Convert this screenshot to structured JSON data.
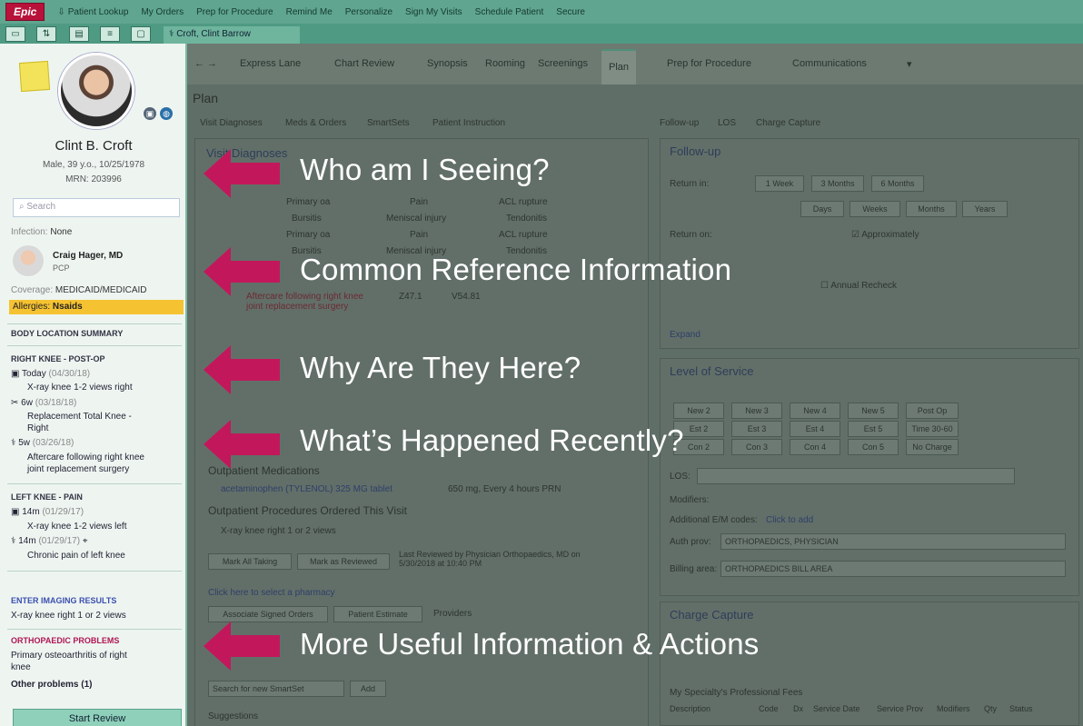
{
  "toolbar": {
    "brand": "Epic",
    "items": [
      "Patient Lookup",
      "My Orders",
      "Prep for Procedure",
      "Remind Me",
      "Personalize",
      "Sign My Visits",
      "Schedule Patient",
      "Secure"
    ]
  },
  "patient_tab": {
    "label": "Croft, Clint Barrow"
  },
  "sidebar": {
    "name": "Clint B. Croft",
    "demographics": "Male, 39 y.o., 10/25/1978",
    "mrn": "MRN: 203996",
    "search_placeholder": "Search",
    "infection_label": "Infection:",
    "infection_value": "None",
    "pcp_name": "Craig Hager, MD",
    "pcp_role": "PCP",
    "coverage_label": "Coverage:",
    "coverage_value": "MEDICAID/MEDICAID",
    "allergies_label": "Allergies:",
    "allergies_value": "Nsaids",
    "body_location_header": "BODY LOCATION SUMMARY",
    "right_knee_header": "RIGHT KNEE - POST-OP",
    "rk1_when": "Today",
    "rk1_date": "(04/30/18)",
    "rk1_desc": "X-ray knee 1-2 views right",
    "rk2_when": "6w",
    "rk2_date": "(03/18/18)",
    "rk2_desc1": "Replacement Total Knee -",
    "rk2_desc2": "Right",
    "rk3_when": "5w",
    "rk3_date": "(03/26/18)",
    "rk3_desc1": "Aftercare following right knee",
    "rk3_desc2": "joint replacement surgery",
    "left_knee_header": "LEFT KNEE - PAIN",
    "lk1_when": "14m",
    "lk1_date": "(01/29/17)",
    "lk1_desc": "X-ray knee 1-2 views left",
    "lk2_when": "14m",
    "lk2_date": "(01/29/17)",
    "lk2_desc": "Chronic pain of left knee",
    "imaging_header": "ENTER IMAGING RESULTS",
    "imaging_item": "X-ray knee right 1 or 2 views",
    "ortho_header": "ORTHOPAEDIC PROBLEMS",
    "ortho_item1": "Primary osteoarthritis of right",
    "ortho_item2": "knee",
    "other_problems": "Other problems (1)",
    "start_review": "Start Review"
  },
  "nav": {
    "tabs": [
      "Express Lane",
      "Chart Review",
      "Synopsis",
      "Rooming",
      "Screenings",
      "Plan",
      "Prep for Procedure",
      "Communications"
    ]
  },
  "plan": {
    "title": "Plan",
    "subtabs": [
      "Visit Diagnoses",
      "Meds & Orders",
      "SmartSets",
      "Patient Instruction"
    ],
    "right_subtabs": [
      "Follow-up",
      "LOS",
      "Charge Capture"
    ],
    "visit_dx_title": "Visit Diagnoses",
    "dx_grid": [
      "Primary oa",
      "Pain",
      "ACL rupture",
      "Bursitis",
      "Meniscal injury",
      "Tendonitis",
      "Primary oa",
      "Pain",
      "ACL rupture",
      "Bursitis",
      "Meniscal injury",
      "Tendonitis"
    ],
    "dx_item": "Aftercare following right knee joint replacement surgery",
    "dx_code1": "Z47.1",
    "dx_code2": "V54.81",
    "outpatient_meds": "Outpatient Medications",
    "med_line": "acetaminophen (TYLENOL) 325 MG tablet",
    "med_dose": "650 mg, Every 4 hours PRN",
    "outpatient_procs": "Outpatient Procedures Ordered This Visit",
    "proc_line": "X-ray knee right 1 or 2 views",
    "mark_taking": "Mark All Taking",
    "mark_reviewed": "Mark as Reviewed",
    "last_reviewed": "Last Reviewed by Physician Orthopaedics, MD on 5/30/2018 at 10:40 PM",
    "pharmacy_link": "Click here to select a pharmacy",
    "associate_orders": "Associate Signed Orders",
    "patient_estimate": "Patient Estimate",
    "providers": "Providers",
    "search_smartset": "Search for new SmartSet",
    "add": "Add",
    "suggestions": "Suggestions"
  },
  "followup": {
    "title": "Follow-up",
    "return_in": "Return in:",
    "btns1": [
      "1 Week",
      "3 Months",
      "6 Months"
    ],
    "btns2": [
      "Days",
      "Weeks",
      "Months",
      "Years"
    ],
    "return_on": "Return on:",
    "approximately": "Approximately",
    "annual_recheck": "Annual Recheck",
    "expand": "Expand"
  },
  "los": {
    "title": "Level of Service",
    "codes": [
      "New 2",
      "New 3",
      "New 4",
      "New 5",
      "Post Op",
      "Est 2",
      "Est 3",
      "Est 4",
      "Est 5",
      "Time 30-60",
      "Con 2",
      "Con 3",
      "Con 4",
      "Con 5",
      "No Charge"
    ],
    "los_label": "LOS:",
    "modifiers": "Modifiers:",
    "additional_em": "Additional E/M codes:",
    "click_to_add": "Click to add",
    "auth_prov_label": "Auth prov:",
    "auth_prov_value": "ORTHOPAEDICS, PHYSICIAN",
    "billing_label": "Billing area:",
    "billing_value": "ORTHOPAEDICS BILL AREA"
  },
  "charge": {
    "title": "Charge Capture",
    "fees": "My Specialty's Professional Fees",
    "cols": [
      "Description",
      "Code",
      "Dx",
      "Service Date",
      "Service Prov",
      "Modifiers",
      "Qty",
      "Status"
    ]
  },
  "callouts": [
    "Who am I Seeing?",
    "Common Reference Information",
    "Why Are They Here?",
    "What’s Happened Recently?",
    "More Useful Information & Actions"
  ],
  "colors": {
    "arrow": "#c2185b",
    "overlay": "#4c5a53",
    "brand": "#b8123a",
    "allergy": "#f5c232"
  }
}
